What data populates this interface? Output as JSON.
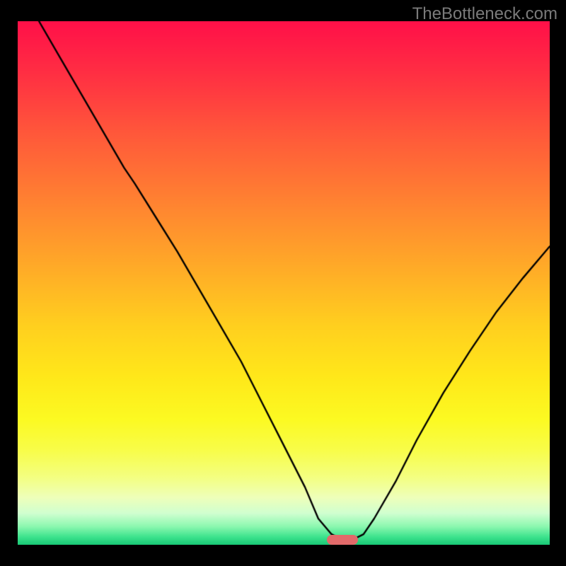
{
  "attribution": "TheBottleneck.com",
  "chart_data": {
    "type": "line",
    "title": "",
    "xlabel": "",
    "ylabel": "",
    "xlim": [
      0,
      100
    ],
    "ylim": [
      0,
      100
    ],
    "series": [
      {
        "name": "bottleneck-curve",
        "x": [
          4,
          8,
          12,
          16,
          20,
          22,
          26,
          30,
          34,
          38,
          42,
          46,
          50,
          54,
          56.5,
          59,
          61,
          63,
          65,
          67,
          71,
          75,
          80,
          85,
          90,
          95,
          100
        ],
        "values": [
          100,
          93,
          86,
          79,
          72,
          69,
          62.5,
          56,
          49,
          42,
          35,
          27,
          19,
          11,
          5,
          2,
          1,
          1,
          2,
          5,
          12,
          20,
          29,
          37,
          44.5,
          51,
          57
        ]
      }
    ],
    "marker": {
      "x_center": 61,
      "y": 1,
      "color": "#e26a6a"
    },
    "gradient_stops": [
      {
        "pos": 0.0,
        "color": "#ff1049"
      },
      {
        "pos": 0.1,
        "color": "#ff2f43"
      },
      {
        "pos": 0.22,
        "color": "#ff5a3a"
      },
      {
        "pos": 0.35,
        "color": "#ff8431"
      },
      {
        "pos": 0.48,
        "color": "#ffae27"
      },
      {
        "pos": 0.58,
        "color": "#ffcf1f"
      },
      {
        "pos": 0.68,
        "color": "#ffe81a"
      },
      {
        "pos": 0.76,
        "color": "#fcfa22"
      },
      {
        "pos": 0.82,
        "color": "#f8fd4a"
      },
      {
        "pos": 0.87,
        "color": "#f4ff80"
      },
      {
        "pos": 0.91,
        "color": "#eeffba"
      },
      {
        "pos": 0.94,
        "color": "#d0ffd0"
      },
      {
        "pos": 0.965,
        "color": "#8cf8b0"
      },
      {
        "pos": 0.985,
        "color": "#3de38d"
      },
      {
        "pos": 1.0,
        "color": "#19c876"
      }
    ],
    "line_color": "#000000",
    "line_width": 2.4
  }
}
